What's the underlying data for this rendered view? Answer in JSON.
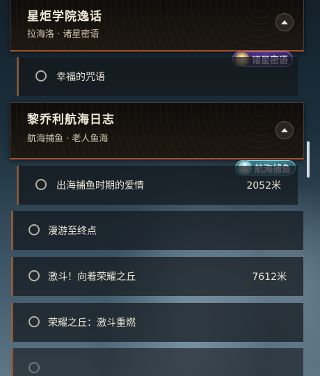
{
  "sections": [
    {
      "title": "星炬学院逸话",
      "subtitle": "拉海洛 · 诸星密语",
      "tag": "诸星密语",
      "tag_icon": "star-compass-icon",
      "items": [
        {
          "label": "幸福的咒语",
          "distance": ""
        }
      ]
    },
    {
      "title": "黎乔利航海日志",
      "subtitle": "航海捕鱼 · 老人鱼海",
      "tag": "航海捕鱼",
      "tag_icon": "anchor-icon",
      "items": [
        {
          "label": "出海捕鱼时期的爱情",
          "distance": "2052米"
        }
      ]
    }
  ],
  "quests": [
    {
      "label": "漫游至终点",
      "distance": ""
    },
    {
      "label": "激斗！向着荣耀之丘",
      "distance": "7612米"
    },
    {
      "label": "荣耀之丘：激斗重燃",
      "distance": ""
    }
  ],
  "colors": {
    "accent_border": "#a4522e",
    "tag_purple": "#4c3289",
    "tag_teal": "#3b8b98"
  }
}
